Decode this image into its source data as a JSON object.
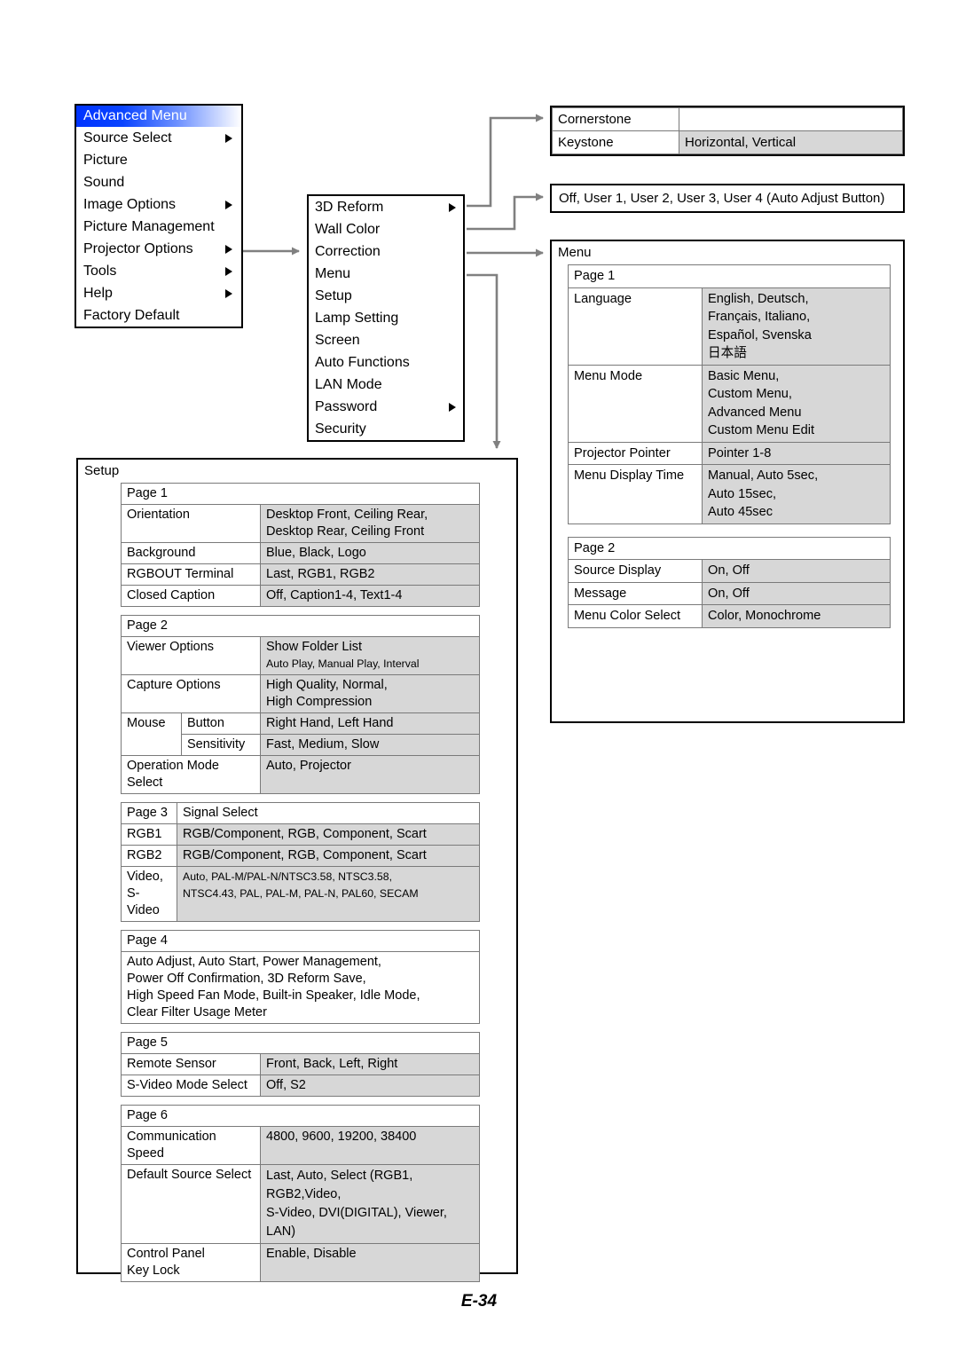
{
  "page": {
    "footer": "E-34"
  },
  "osd_menu": {
    "title": "Advanced Menu",
    "items": [
      {
        "label": "Source Select",
        "arrow": true
      },
      {
        "label": "Picture",
        "arrow": false
      },
      {
        "label": "Sound",
        "arrow": false
      },
      {
        "label": "Image Options",
        "arrow": true
      },
      {
        "label": "Picture Management",
        "arrow": false
      },
      {
        "label": "Projector Options",
        "arrow": true
      },
      {
        "label": "Tools",
        "arrow": true
      },
      {
        "label": "Help",
        "arrow": true
      },
      {
        "label": "Factory Default",
        "arrow": false
      }
    ]
  },
  "projector_options": {
    "items": [
      {
        "label": "3D Reform",
        "arrow": true
      },
      {
        "label": "Wall Color Correction",
        "arrow": false
      },
      {
        "label": "Menu",
        "arrow": false
      },
      {
        "label": "Setup",
        "arrow": false
      },
      {
        "label": "Lamp Setting",
        "arrow": false
      },
      {
        "label": "Screen",
        "arrow": false
      },
      {
        "label": "Auto Functions",
        "arrow": false
      },
      {
        "label": "LAN Mode",
        "arrow": false
      },
      {
        "label": "Password",
        "arrow": true
      },
      {
        "label": "Security",
        "arrow": false
      }
    ]
  },
  "cornerstone_box": {
    "row1_label": "Cornerstone",
    "row1_value": "",
    "row2_label": "Keystone",
    "row2_value": "Horizontal, Vertical"
  },
  "wall_color_box": {
    "text": "Off, User 1, User 2, User 3, User 4 (Auto  Adjust Button)"
  },
  "menu_panel": {
    "title": "Menu",
    "page1": {
      "header": "Page 1",
      "rows": [
        {
          "label": "Language",
          "value": "English, Deutsch,\nFrançais, Italiano,\nEspañol, Svenska\n日本語"
        },
        {
          "label": "Menu Mode",
          "value": "Basic Menu,\nCustom Menu,\nAdvanced Menu\nCustom Menu Edit"
        },
        {
          "label": "Projector Pointer",
          "value": "Pointer 1-8"
        },
        {
          "label": "Menu Display Time",
          "value": "Manual, Auto 5sec,\nAuto 15sec,\nAuto 45sec"
        }
      ]
    },
    "page2": {
      "header": "Page 2",
      "rows": [
        {
          "label": "Source Display",
          "value": "On, Off"
        },
        {
          "label": "Message",
          "value": "On, Off"
        },
        {
          "label": "Menu Color Select",
          "value": "Color, Monochrome"
        }
      ]
    }
  },
  "setup_panel": {
    "title": "Setup",
    "page1": {
      "header": "Page 1",
      "rows": [
        {
          "label": "Orientation",
          "value": "Desktop Front, Ceiling Rear,\nDesktop Rear, Ceiling Front"
        },
        {
          "label": "Background",
          "value": "Blue, Black, Logo"
        },
        {
          "label": "RGBOUT Terminal",
          "value": "Last, RGB1, RGB2"
        },
        {
          "label": "Closed Caption",
          "value": "Off, Caption1-4, Text1-4"
        }
      ]
    },
    "page2": {
      "header": "Page 2",
      "viewer_label": "Viewer Options",
      "viewer_value_line1": "Show Folder List",
      "viewer_value_line2": "Auto Play, Manual Play, Interval",
      "capture_label": "Capture Options",
      "capture_value": "High Quality, Normal,\nHigh Compression",
      "mouse_label": "Mouse",
      "mouse_button_label": "Button",
      "mouse_button_value": "Right Hand, Left Hand",
      "mouse_sens_label": "Sensitivity",
      "mouse_sens_value": "Fast, Medium, Slow",
      "opmode_label": "Operation Mode Select",
      "opmode_value": "Auto, Projector"
    },
    "page3": {
      "header": "Page 3",
      "header2": "Signal Select",
      "rows": [
        {
          "label": "RGB1",
          "value": "RGB/Component, RGB, Component, Scart"
        },
        {
          "label": "RGB2",
          "value": "RGB/Component, RGB, Component, Scart"
        }
      ],
      "video_label_line1": "Video,",
      "video_label_line2": "S-Video",
      "video_value_line1": "Auto, PAL-M/PAL-N/NTSC3.58, NTSC3.58,",
      "video_value_line2": "NTSC4.43, PAL, PAL-M, PAL-N, PAL60, SECAM"
    },
    "page4": {
      "header": "Page 4",
      "lines": [
        "Auto Adjust, Auto Start, Power Management,",
        "Power Off Confirmation, 3D Reform Save,",
        "High Speed Fan Mode, Built-in Speaker, Idle Mode,",
        "Clear Filter Usage Meter"
      ]
    },
    "page5": {
      "header": "Page 5",
      "rows": [
        {
          "label": "Remote Sensor",
          "value": "Front, Back, Left, Right"
        },
        {
          "label": "S-Video Mode Select",
          "value": "Off, S2"
        }
      ]
    },
    "page6": {
      "header": "Page 6",
      "comm_label": "Communication Speed",
      "comm_value": "4800, 9600, 19200, 38400",
      "defsrc_label": "Default Source Select",
      "defsrc_value": "Last, Auto, Select (RGB1, RGB2,Video,\nS-Video, DVI(DIGITAL), Viewer, LAN)",
      "ctrl_label": "Control Panel\nKey Lock",
      "ctrl_value": "Enable, Disable"
    }
  },
  "colors": {
    "value_cell_bg": "#d7d7d7",
    "osd_highlight": "#0033ff",
    "wire": "#808080",
    "border": "#000000"
  }
}
